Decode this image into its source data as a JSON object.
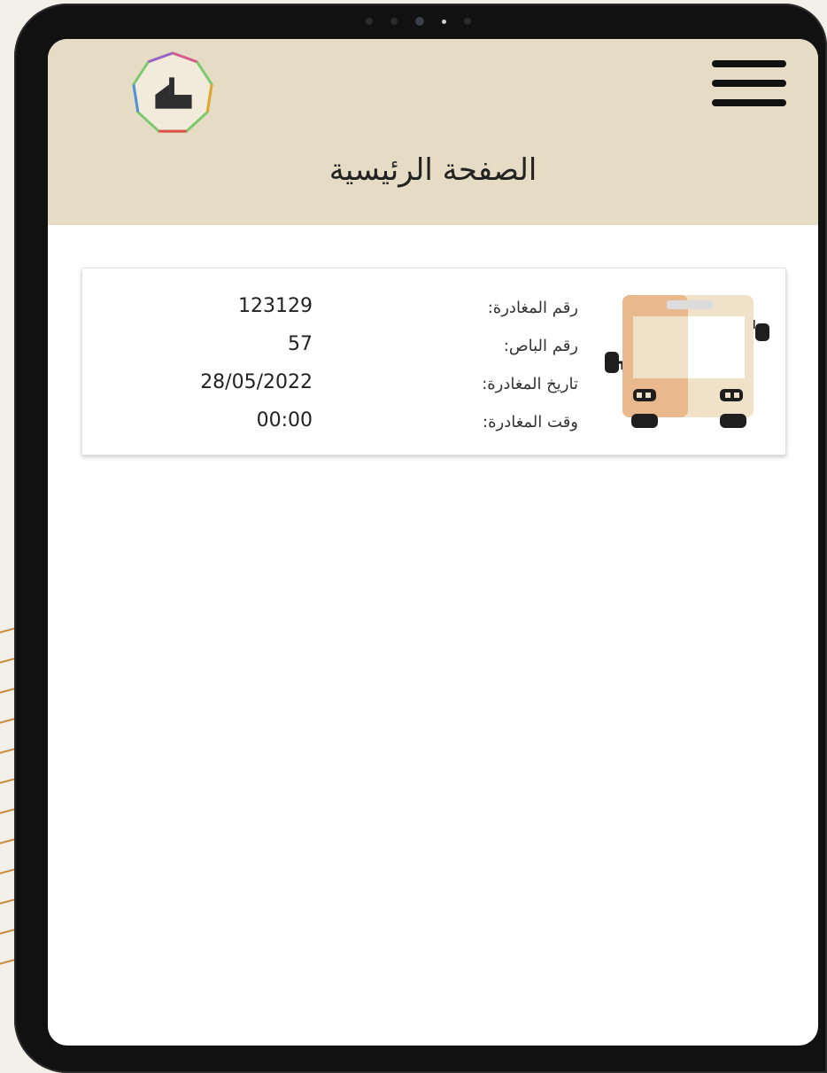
{
  "header": {
    "title": "الصفحة الرئيسية",
    "menu_icon": "hamburger-menu-icon",
    "logo_icon": "makkah-logo-icon"
  },
  "trip_card": {
    "icon": "bus-icon",
    "rows": [
      {
        "label": "رقم المغادرة:",
        "value": "123129"
      },
      {
        "label": "رقم الباص:",
        "value": "57"
      },
      {
        "label": "تاريخ المغادرة:",
        "value": "28/05/2022"
      },
      {
        "label": "وقت المغادرة:",
        "value": "00:00"
      }
    ]
  },
  "colors": {
    "header_bg": "#e6dcc5",
    "bus_orange": "#e9b88c",
    "bus_cream": "#efe2c9"
  }
}
